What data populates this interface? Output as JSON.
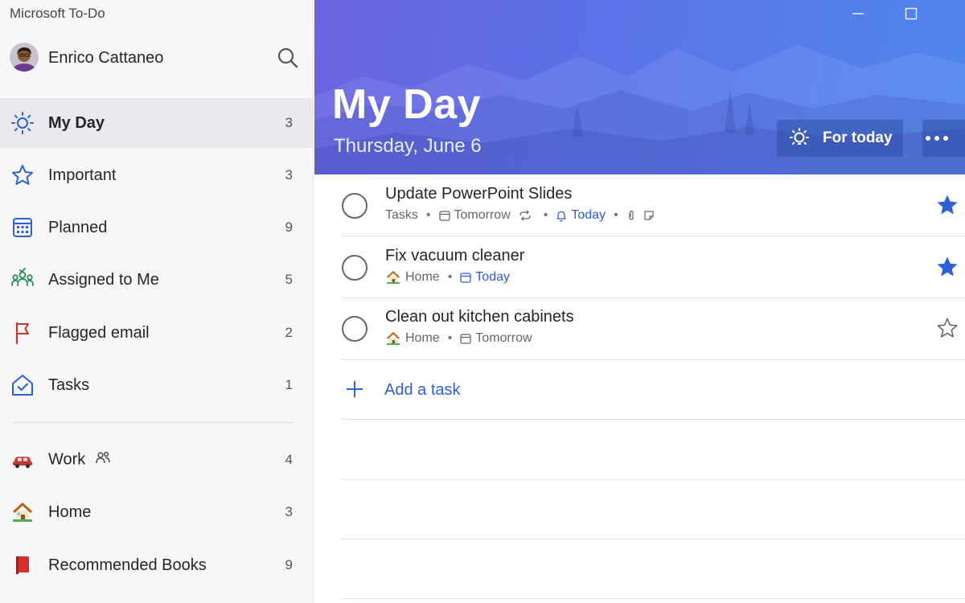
{
  "app": {
    "title": "Microsoft To-Do"
  },
  "profile": {
    "name": "Enrico Cattaneo"
  },
  "sidebar": {
    "items": [
      {
        "label": "My Day",
        "count": "3",
        "icon": "sun-icon",
        "active": true
      },
      {
        "label": "Important",
        "count": "3",
        "icon": "star-icon"
      },
      {
        "label": "Planned",
        "count": "9",
        "icon": "calendar-icon"
      },
      {
        "label": "Assigned to Me",
        "count": "5",
        "icon": "people-icon"
      },
      {
        "label": "Flagged email",
        "count": "2",
        "icon": "flag-icon"
      },
      {
        "label": "Tasks",
        "count": "1",
        "icon": "home-check-icon"
      }
    ],
    "lists": [
      {
        "label": "Work",
        "count": "4",
        "icon": "car-emoji-icon",
        "shared": true
      },
      {
        "label": "Home",
        "count": "3",
        "icon": "house-emoji-icon"
      },
      {
        "label": "Recommended Books",
        "count": "9",
        "icon": "book-emoji-icon"
      }
    ]
  },
  "header": {
    "title": "My Day",
    "date": "Thursday, June 6",
    "for_today_label": "For today",
    "colors": {
      "gradient_start": "#6b63e0",
      "gradient_end": "#4f86ec"
    }
  },
  "tasks": [
    {
      "title": "Update PowerPoint Slides",
      "list": "Tasks",
      "due": "Tomorrow",
      "reminder": "Today",
      "important": true
    },
    {
      "title": "Fix vacuum cleaner",
      "list": "Home",
      "due": "Today",
      "important": true
    },
    {
      "title": "Clean out kitchen cabinets",
      "list": "Home",
      "due": "Tomorrow",
      "important": false
    }
  ],
  "add_task": {
    "label": "Add a task"
  },
  "colors": {
    "accent": "#2d5fd6",
    "star_filled": "#2d5fd6"
  }
}
